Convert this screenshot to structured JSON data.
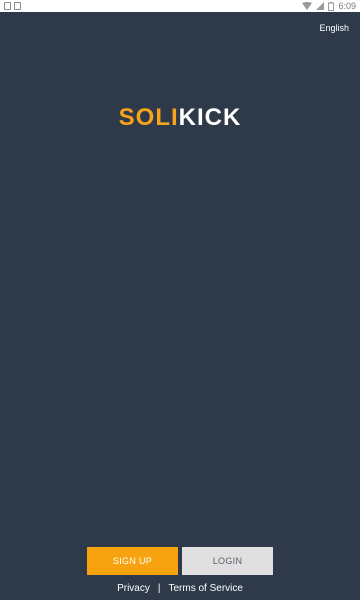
{
  "status_bar": {
    "time": "6:09",
    "left_icons": [
      "notification-icon",
      "sd-card-icon"
    ],
    "right_icons": [
      "wifi-icon",
      "signal-icon",
      "battery-icon"
    ]
  },
  "header": {
    "language": "English"
  },
  "logo": {
    "part_a": "SOLI",
    "part_b": "KICK",
    "part_a_color": "#f7a31c",
    "part_b_color": "#ffffff"
  },
  "actions": {
    "signup_label": "SIGN UP",
    "login_label": "LOGIN"
  },
  "footer": {
    "privacy_label": "Privacy",
    "separator": "|",
    "terms_label": "Terms of Service"
  },
  "colors": {
    "background": "#2e3a49",
    "accent": "#f7a20f",
    "login_bg": "#e0e0e0"
  }
}
